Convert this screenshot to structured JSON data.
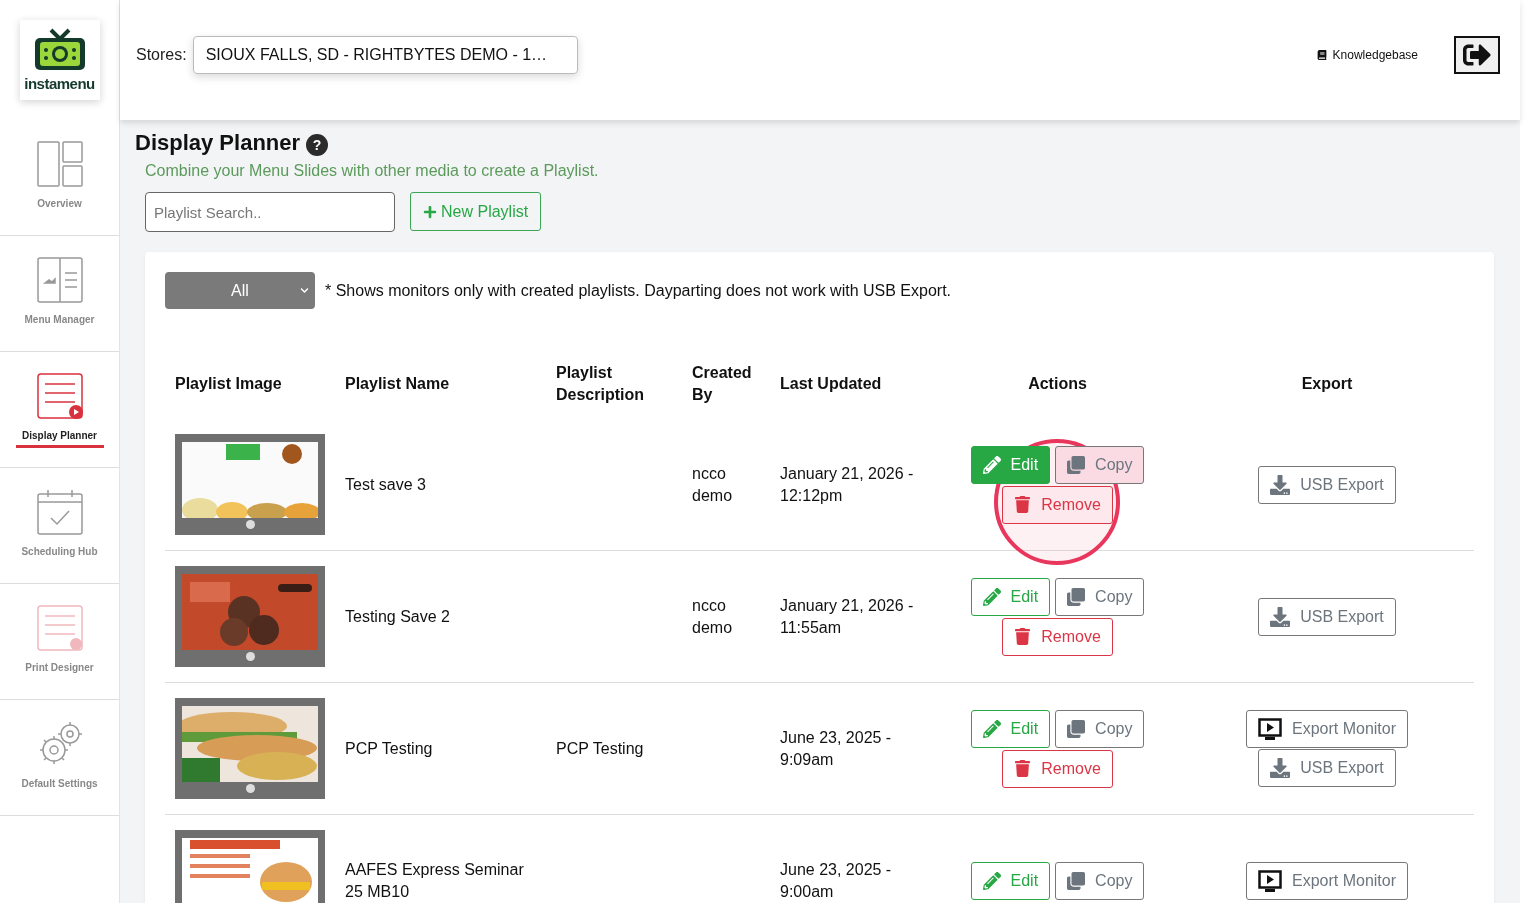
{
  "logo": {
    "text": "instamenu"
  },
  "header": {
    "stores_label": "Stores:",
    "store_value": "SIOUX FALLS, SD - RIGHTBYTES DEMO - 1…",
    "knowledgebase": "Knowledgebase"
  },
  "sidebar": {
    "items": [
      {
        "label": "Overview",
        "kind": "overview",
        "selected": false
      },
      {
        "label": "Menu Manager",
        "kind": "menu",
        "selected": false
      },
      {
        "label": "Display Planner",
        "kind": "display",
        "selected": true
      },
      {
        "label": "Scheduling Hub",
        "kind": "schedule",
        "selected": false
      },
      {
        "label": "Print Designer",
        "kind": "print",
        "selected": false
      },
      {
        "label": "Default Settings",
        "kind": "settings",
        "selected": false
      }
    ]
  },
  "page": {
    "title": "Display Planner",
    "help": "?",
    "subtitle": "Combine your Menu Slides with other media to create a Playlist.",
    "search_placeholder": "Playlist Search..",
    "new_button": "New Playlist"
  },
  "filter": {
    "value": "All",
    "note": "* Shows monitors only with created playlists. Dayparting does not work with USB Export."
  },
  "table": {
    "columns": [
      "Playlist Image",
      "Playlist Name",
      "Playlist Description",
      "Created By",
      "Last Updated",
      "Actions",
      "Export"
    ],
    "rows": [
      {
        "image": {
          "kind": "picture",
          "dot": true
        },
        "name": "Test save 3",
        "created_by": "ncco demo",
        "updated": "January 21, 2026 - 12:12pm",
        "edit": "Edit",
        "copy": "Copy",
        "remove": "Remove",
        "edit_active": true,
        "circled": true,
        "exports": [
          {
            "kind": "usb",
            "label": "USB Export"
          }
        ]
      },
      {
        "image": {
          "kind": "picture",
          "dot": true
        },
        "name": "Testing Save 2",
        "created_by": "ncco demo",
        "updated": "January 21, 2026 - 11:55am",
        "edit": "Edit",
        "copy": "Copy",
        "remove": "Remove",
        "edit_active": false,
        "circled": false,
        "exports": [
          {
            "kind": "usb",
            "label": "USB Export"
          }
        ]
      },
      {
        "image": {
          "kind": "picture",
          "dot": true
        },
        "name": "PCP Testing",
        "description": "PCP Testing",
        "updated": "June 23, 2025 - 9:09am",
        "edit": "Edit",
        "copy": "Copy",
        "remove": "Remove",
        "edit_active": false,
        "circled": false,
        "exports": [
          {
            "kind": "monitor",
            "label": "Export Monitor"
          },
          {
            "kind": "usb",
            "label": "USB Export"
          }
        ]
      },
      {
        "image": {
          "kind": "picture"
        },
        "name": "AAFES Express Seminar 25 MB10",
        "updated": "June 23, 2025 - 9:00am",
        "edit": "Edit",
        "copy": "Copy",
        "edit_active": false,
        "circled": false,
        "exports": [
          {
            "kind": "monitor",
            "label": "Export Monitor"
          }
        ]
      }
    ]
  }
}
